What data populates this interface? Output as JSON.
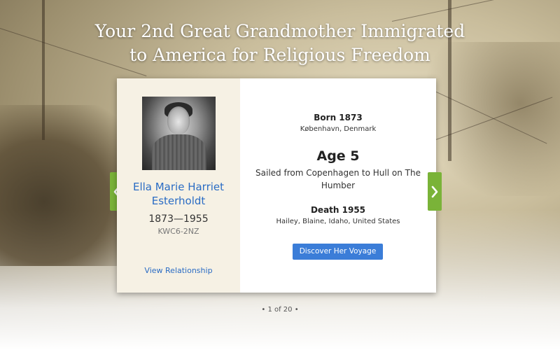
{
  "headline": {
    "line1": "Your 2nd Great Grandmother Immigrated",
    "line2": "to America for Religious Freedom"
  },
  "person": {
    "name": "Ella Marie Harriet Esterholdt",
    "lifespan": "1873—1955",
    "id": "KWC6-2NZ",
    "view_relationship": "View Relationship"
  },
  "event": {
    "born_label": "Born 1873",
    "born_place": "København, Denmark",
    "age_label": "Age 5",
    "voyage_description": "Sailed from Copenhagen to Hull on The Humber",
    "death_label": "Death 1955",
    "death_place": "Hailey, Blaine, Idaho, United States",
    "discover_button": "Discover Her Voyage"
  },
  "navigation": {
    "prev_icon": "chevron-left-icon",
    "next_icon": "chevron-right-icon",
    "pager": "• 1 of 20 •"
  },
  "colors": {
    "accent_green": "#7ab338",
    "link_blue": "#2a6cc4",
    "button_blue": "#3b7dd8",
    "card_left_bg": "#f6f1e4"
  }
}
